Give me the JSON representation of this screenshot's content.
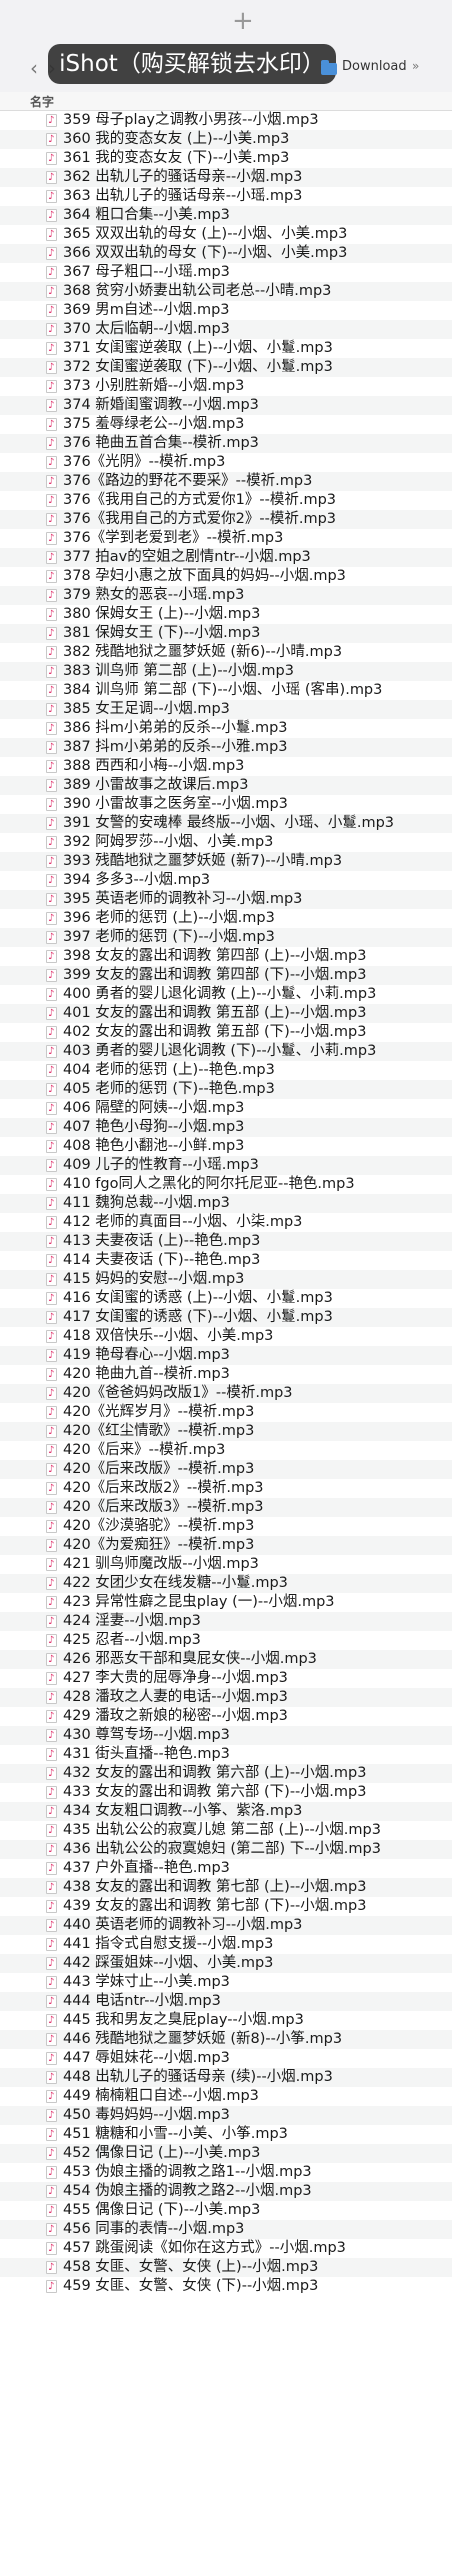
{
  "toolbar": {
    "watermark": "iShot（购买解锁去水印）",
    "location": "Download",
    "column_header": "名字"
  },
  "files": [
    "359 母子play之调教小男孩--小烟.mp3",
    "360 我的变态女友 (上)--小美.mp3",
    "361 我的变态女友 (下)--小美.mp3",
    "362 出轨儿子的骚话母亲--小烟.mp3",
    "363 出轨儿子的骚话母亲--小瑶.mp3",
    "364 粗口合集--小美.mp3",
    "365 双双出轨的母女 (上)--小烟、小美.mp3",
    "366 双双出轨的母女 (下)--小烟、小美.mp3",
    "367 母子粗口--小瑶.mp3",
    "368 贫穷小娇妻出轨公司老总--小晴.mp3",
    "369 男m自述--小烟.mp3",
    "370 太后临朝--小烟.mp3",
    "371 女闺蜜逆袭取 (上)--小烟、小鬘.mp3",
    "372 女闺蜜逆袭取 (下)--小烟、小鬘.mp3",
    "373 小别胜新婚--小烟.mp3",
    "374 新婚闺蜜调教--小烟.mp3",
    "375 羞辱绿老公--小烟.mp3",
    "376 艳曲五首合集--模祈.mp3",
    "376《光阴》--模祈.mp3",
    "376《路边的野花不要采》--模祈.mp3",
    "376《我用自己的方式爱你1》--模祈.mp3",
    "376《我用自己的方式爱你2》--模祈.mp3",
    "376《学到老爱到老》--模祈.mp3",
    "377 拍av的空姐之剧情ntr--小烟.mp3",
    "378 孕妇小惠之放下面具的妈妈--小烟.mp3",
    "379 熟女的恶哀--小瑶.mp3",
    "380 保姆女王 (上)--小烟.mp3",
    "381 保姆女王 (下)--小烟.mp3",
    "382 残酷地狱之噩梦妖姬 (新6)--小晴.mp3",
    "383 训鸟师 第二部 (上)--小烟.mp3",
    "384 训鸟师 第二部 (下)--小烟、小瑶 (客串).mp3",
    "385 女王足调--小烟.mp3",
    "386 抖m小弟弟的反杀--小鬘.mp3",
    "387 抖m小弟弟的反杀--小雅.mp3",
    "388 西西和小梅--小烟.mp3",
    "389 小雷故事之故课后.mp3",
    "390 小雷故事之医务室--小烟.mp3",
    "391 女警的安魂棒 最终版--小烟、小瑶、小鬘.mp3",
    "392 阿姆罗莎--小烟、小美.mp3",
    "393 残酷地狱之噩梦妖姬 (新7)--小晴.mp3",
    "394 多多3--小烟.mp3",
    "395 英语老师的调教补习--小烟.mp3",
    "396 老师的惩罚 (上)--小烟.mp3",
    "397 老师的惩罚 (下)--小烟.mp3",
    "398 女友的露出和调教 第四部 (上)--小烟.mp3",
    "399 女友的露出和调教 第四部 (下)--小烟.mp3",
    "400 勇者的婴儿退化调教 (上)--小鬘、小莉.mp3",
    "401 女友的露出和调教 第五部 (上)--小烟.mp3",
    "402 女友的露出和调教 第五部 (下)--小烟.mp3",
    "403 勇者的婴儿退化调教 (下)--小鬘、小莉.mp3",
    "404 老师的惩罚 (上)--艳色.mp3",
    "405 老师的惩罚 (下)--艳色.mp3",
    "406 隔壁的阿姨--小烟.mp3",
    "407 艳色小母狗--小烟.mp3",
    "408 艳色小翻池--小鲜.mp3",
    "409 儿子的性教育--小瑶.mp3",
    "410 fgo同人之黑化的阿尔托尼亚--艳色.mp3",
    "411 魏狗总裁--小烟.mp3",
    "412 老师的真面目--小烟、小柒.mp3",
    "413 夫妻夜话 (上)--艳色.mp3",
    "414 夫妻夜话 (下)--艳色.mp3",
    "415 妈妈的安慰--小烟.mp3",
    "416 女闺蜜的诱惑 (上)--小烟、小鬘.mp3",
    "417 女闺蜜的诱惑 (下)--小烟、小鬘.mp3",
    "418 双倍快乐--小烟、小美.mp3",
    "419 艳母春心--小烟.mp3",
    "420 艳曲九首--模祈.mp3",
    "420《爸爸妈妈改版1》--模祈.mp3",
    "420《光辉岁月》--模祈.mp3",
    "420《红尘情歌》--模祈.mp3",
    "420《后来》--模祈.mp3",
    "420《后来改版》--模祈.mp3",
    "420《后来改版2》--模祈.mp3",
    "420《后来改版3》--模祈.mp3",
    "420《沙漠骆驼》--模祈.mp3",
    "420《为爱痴狂》--模祈.mp3",
    "421 驯鸟师魔改版--小烟.mp3",
    "422 女团少女在线发糖--小鬘.mp3",
    "423 异常性癖之昆虫play (一)--小烟.mp3",
    "424 淫妻--小烟.mp3",
    "425 忍者--小烟.mp3",
    "426 邪恶女干部和臭屁女侠--小烟.mp3",
    "427 李大贵的屈辱净身--小烟.mp3",
    "428 潘玫之人妻的电话--小烟.mp3",
    "429 潘玫之新娘的秘密--小烟.mp3",
    "430 尊驾专场--小烟.mp3",
    "431 街头直播--艳色.mp3",
    "432 女友的露出和调教 第六部 (上)--小烟.mp3",
    "433 女友的露出和调教 第六部 (下)--小烟.mp3",
    "434 女友粗口调教--小筝、紫洛.mp3",
    "435 出轨公公的寂寞儿媳 第二部 (上)--小烟.mp3",
    "436 出轨公公的寂寞媳妇 (第二部) 下--小烟.mp3",
    "437 户外直播--艳色.mp3",
    "438 女友的露出和调教 第七部 (上)--小烟.mp3",
    "439 女友的露出和调教 第七部 (下)--小烟.mp3",
    "440 英语老师的调教补习--小烟.mp3",
    "441 指令式自慰支援--小烟.mp3",
    "442 踩蛋姐妹--小烟、小美.mp3",
    "443 学妹寸止--小美.mp3",
    "444 电话ntr--小烟.mp3",
    "445 我和男友之臭屁play--小烟.mp3",
    "446 残酷地狱之噩梦妖姬 (新8)--小筝.mp3",
    "447 辱姐妹花--小烟.mp3",
    "448 出轨儿子的骚话母亲 (续)--小烟.mp3",
    "449 楠楠粗口自述--小烟.mp3",
    "450 毒妈妈妈--小烟.mp3",
    "451 糖糖和小雪--小美、小筝.mp3",
    "452 偶像日记 (上)--小美.mp3",
    "453 伪娘主播的调教之路1--小烟.mp3",
    "454 伪娘主播的调教之路2--小烟.mp3",
    "455 偶像日记 (下)--小美.mp3",
    "456 同事的表情--小烟.mp3",
    "457 跳蛋阅读《如你在这方式》--小烟.mp3",
    "458 女匪、女警、女侠 (上)--小烟.mp3",
    "459 女匪、女警、女侠 (下)--小烟.mp3"
  ]
}
